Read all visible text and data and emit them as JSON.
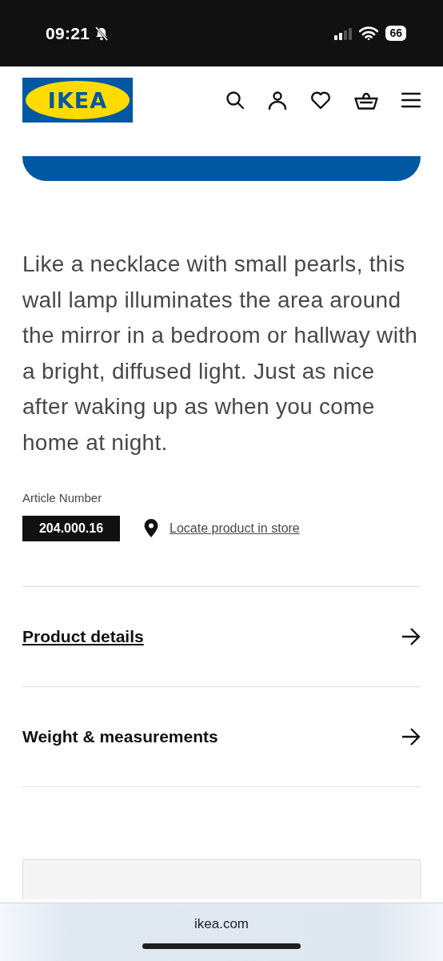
{
  "status_bar": {
    "time": "09:21",
    "silent": true,
    "battery": "66"
  },
  "header": {
    "logo": "IKEA"
  },
  "description": "Like a necklace with small pearls, this wall lamp illuminates the area around the mirror in a bedroom or hallway with a bright, diffused light. Just as nice after waking up as when you come home at night.",
  "article": {
    "label": "Article Number",
    "number": "204.000.16",
    "locate_link": "Locate product in store"
  },
  "sections": [
    {
      "title": "Product details",
      "underlined": true
    },
    {
      "title": "Weight & measurements",
      "underlined": false
    }
  ],
  "browser": {
    "url": "ikea.com"
  }
}
